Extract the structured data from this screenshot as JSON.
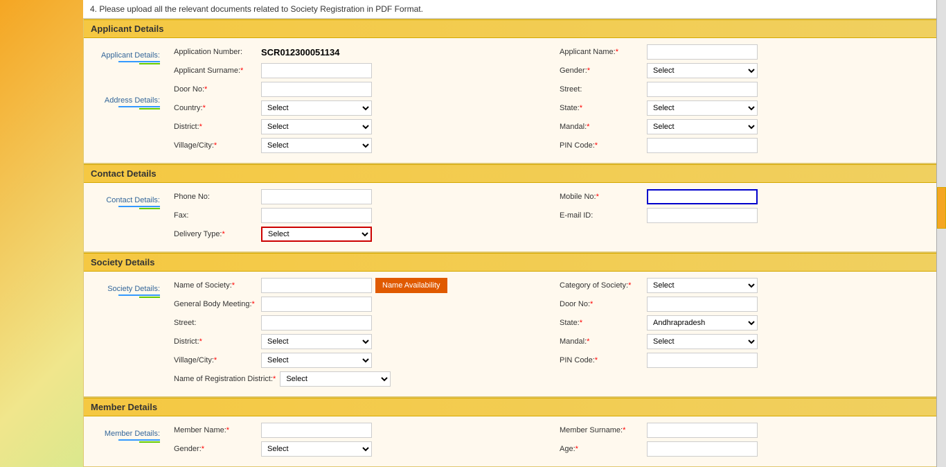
{
  "notice": "4. Please upload all the relevant documents related to Society Registration in PDF Format.",
  "sections": {
    "applicantDetails": {
      "header": "Applicant Details",
      "sidebarLabel1": "Applicant Details:",
      "sidebarLabel2": "Address Details:",
      "fields": {
        "applicationNumber": {
          "label": "Application Number:",
          "value": "SCR012300051134"
        },
        "applicantName": {
          "label": "Applicant Name:",
          "required": true,
          "value": ""
        },
        "applicantSurname": {
          "label": "Applicant Surname:",
          "required": true,
          "value": ""
        },
        "gender": {
          "label": "Gender:",
          "required": true,
          "options": [
            "Select"
          ]
        },
        "doorNo": {
          "label": "Door No:",
          "required": true,
          "value": ""
        },
        "street": {
          "label": "Street:",
          "value": ""
        },
        "country": {
          "label": "Country:",
          "required": true,
          "options": [
            "Select"
          ]
        },
        "state": {
          "label": "State:",
          "required": true,
          "options": [
            "Select"
          ]
        },
        "district": {
          "label": "District:",
          "required": true,
          "options": [
            "Select"
          ]
        },
        "mandal": {
          "label": "Mandal:",
          "required": true,
          "options": [
            "Select"
          ]
        },
        "villageCity": {
          "label": "Village/City:",
          "required": true,
          "options": [
            "Select"
          ]
        },
        "pinCode": {
          "label": "PIN Code:",
          "required": true,
          "value": ""
        }
      }
    },
    "contactDetails": {
      "header": "Contact Details",
      "sidebarLabel": "Contact Details:",
      "fields": {
        "phoneNo": {
          "label": "Phone No:",
          "value": ""
        },
        "mobileNo": {
          "label": "Mobile No:",
          "required": true,
          "value": ""
        },
        "fax": {
          "label": "Fax:",
          "value": ""
        },
        "emailId": {
          "label": "E-mail ID:",
          "value": ""
        },
        "deliveryType": {
          "label": "Delivery Type:",
          "required": true,
          "options": [
            "Select"
          ],
          "highlighted": true
        }
      }
    },
    "societyDetails": {
      "header": "Society Details",
      "sidebarLabel": "Society Details:",
      "fields": {
        "nameOfSociety": {
          "label": "Name of Society:",
          "required": true,
          "value": ""
        },
        "nameAvailButton": "Name Availability",
        "categoryOfSociety": {
          "label": "Category of Society:",
          "required": true,
          "options": [
            "Select"
          ]
        },
        "generalBodyMeeting": {
          "label": "General Body Meeting:",
          "required": true,
          "value": ""
        },
        "doorNo": {
          "label": "Door No:",
          "required": true,
          "value": ""
        },
        "street": {
          "label": "Street:",
          "value": ""
        },
        "state": {
          "label": "State:",
          "required": true,
          "options": [
            "Andhrapradesh"
          ]
        },
        "district": {
          "label": "District:",
          "required": true,
          "options": [
            "Select"
          ]
        },
        "mandal": {
          "label": "Mandal:",
          "required": true,
          "options": [
            "Select"
          ]
        },
        "villageCity": {
          "label": "Village/City:",
          "required": true,
          "options": [
            "Select"
          ]
        },
        "pinCode": {
          "label": "PIN Code:",
          "required": true,
          "value": ""
        },
        "nameOfRegistrationDistrict": {
          "label": "Name of Registration District:",
          "required": true,
          "options": [
            "Select"
          ]
        }
      }
    },
    "memberDetails": {
      "header": "Member Details",
      "sidebarLabel": "Member Details:",
      "fields": {
        "memberName": {
          "label": "Member Name:",
          "required": true,
          "value": ""
        },
        "memberSurname": {
          "label": "Member Surname:",
          "required": true,
          "value": ""
        },
        "gender": {
          "label": "Gender:",
          "required": true,
          "options": [
            "Select"
          ]
        },
        "age": {
          "label": "Age:",
          "required": true,
          "value": ""
        }
      }
    }
  },
  "labels": {
    "select": "Select",
    "andhrapradesh": "Andhrapradesh"
  }
}
